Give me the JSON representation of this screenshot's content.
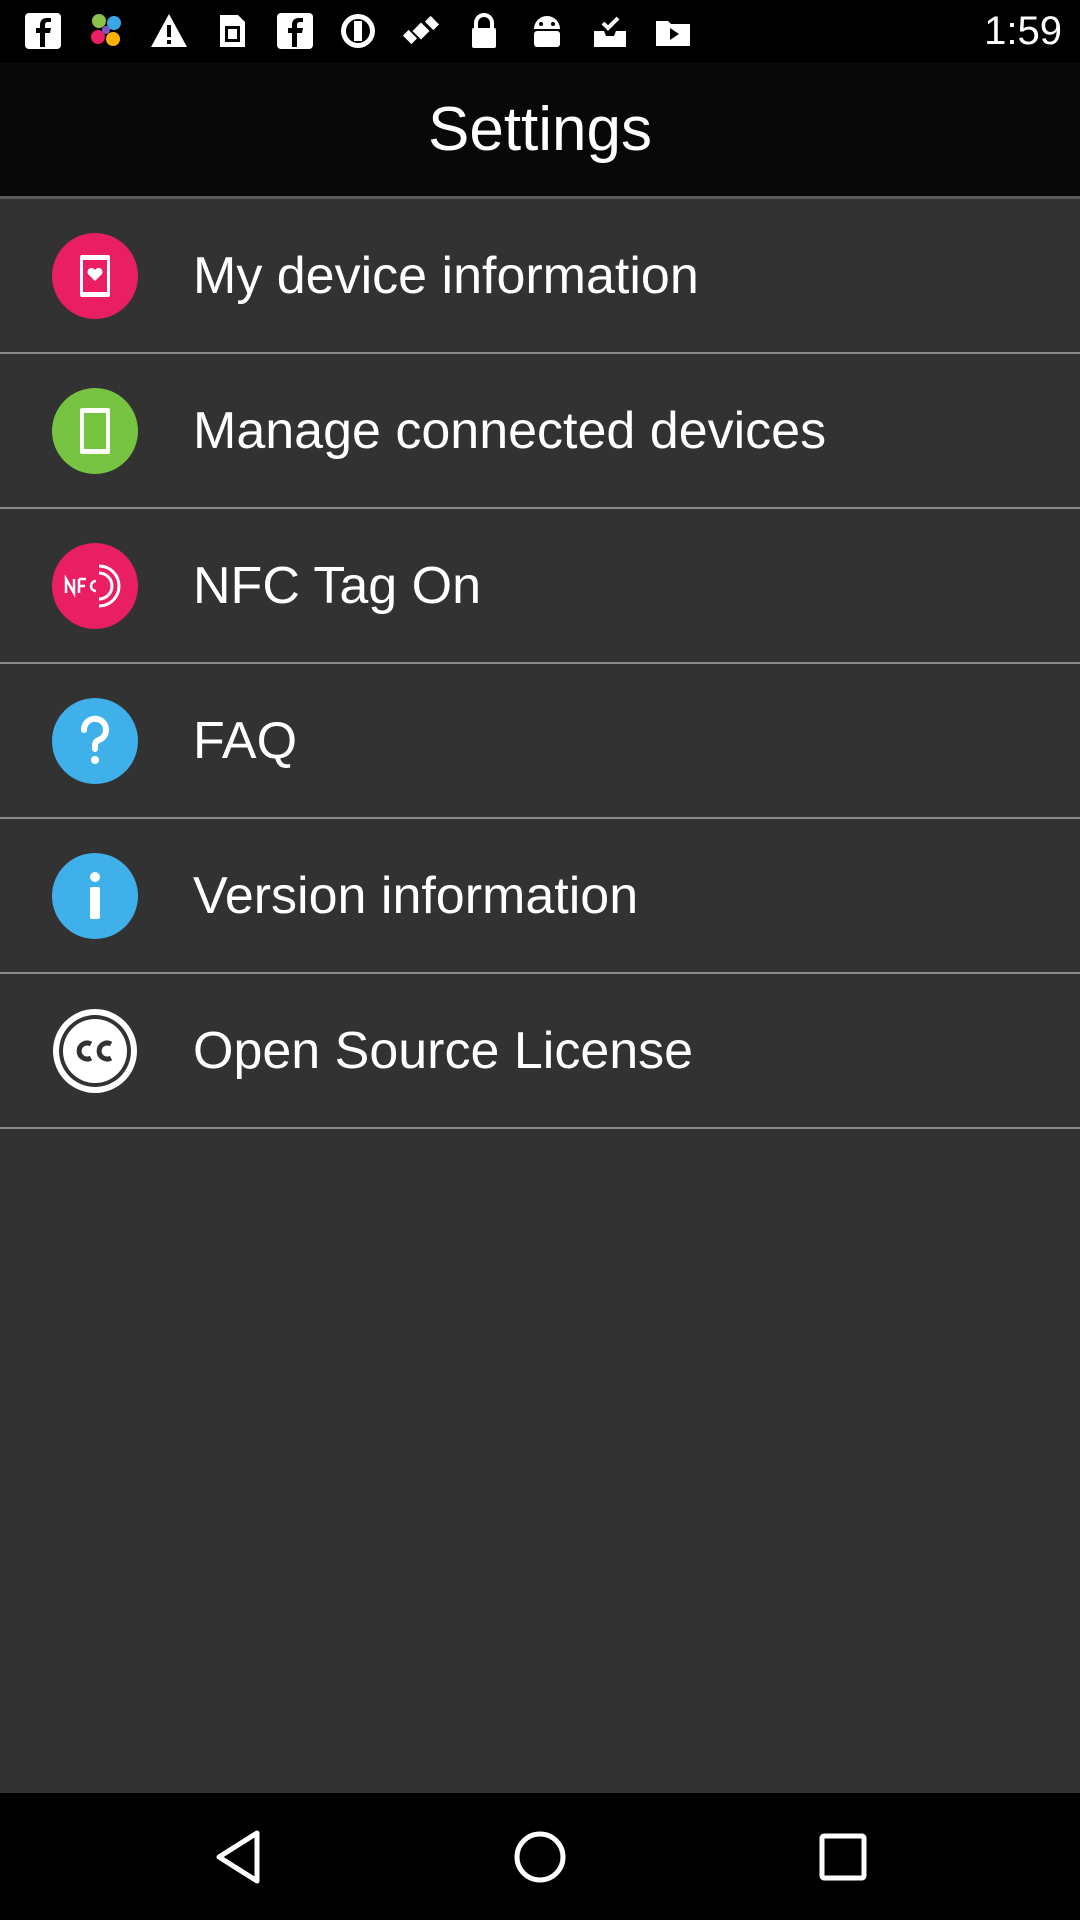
{
  "status_bar": {
    "time": "1:59",
    "icons": [
      "facebook-icon",
      "pinwheel-app-icon",
      "warning-icon",
      "sim-card-icon",
      "facebook-icon",
      "blocked-icon",
      "satellite-fake-gps-icon",
      "lock-icon",
      "android-icon",
      "inbox-check-icon",
      "video-icon"
    ]
  },
  "header": {
    "title": "Settings"
  },
  "settings": {
    "items": [
      {
        "label": "My device information",
        "icon": "device-heart-icon",
        "color": "#e91e63"
      },
      {
        "label": "Manage connected devices",
        "icon": "tablet-icon",
        "color": "#76c442"
      },
      {
        "label": "NFC Tag On",
        "icon": "nfc-icon",
        "color": "#e91e63"
      },
      {
        "label": "FAQ",
        "icon": "question-icon",
        "color": "#3fb0ea"
      },
      {
        "label": "Version information",
        "icon": "info-icon",
        "color": "#3fb0ea"
      },
      {
        "label": "Open Source License",
        "icon": "creative-commons-icon",
        "color": "#ffffff"
      }
    ]
  },
  "navigation": {
    "buttons": [
      "back-icon",
      "home-icon",
      "recents-icon"
    ]
  },
  "colors": {
    "background": "#323232",
    "header": "#080808",
    "divider": "#8a8a8a",
    "text": "#ffffff"
  }
}
